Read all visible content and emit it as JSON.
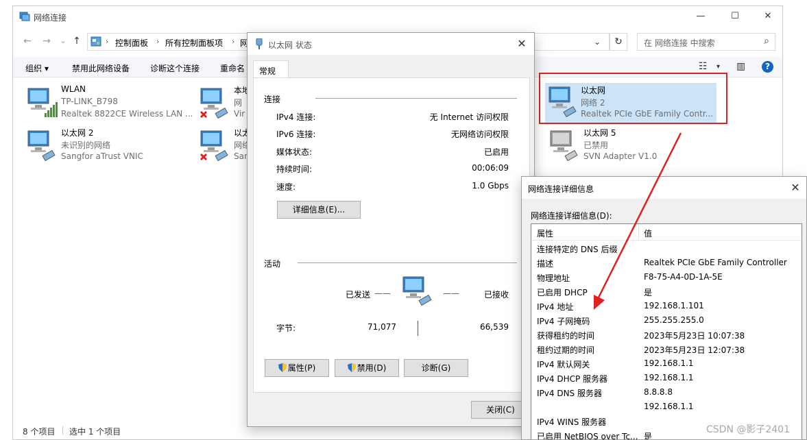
{
  "window": {
    "title": "网络连接",
    "controls": {
      "minimize": "—",
      "maximize": "☐",
      "close": "✕"
    }
  },
  "address": {
    "back": "←",
    "forward": "→",
    "dropdown": "⌄",
    "up": "↑",
    "crumbs": [
      "控制面板",
      "所有控制面板项",
      "网"
    ],
    "sep": "›",
    "dropdown_right": "⌄",
    "refresh": "↻",
    "search_placeholder": "在 网络连接 中搜索",
    "search_icon": "⌕"
  },
  "toolbar": {
    "organize": "组织 ▾",
    "disable": "禁用此网络设备",
    "diagnose": "诊断这个连接",
    "rename": "重命名",
    "view_icon": "☷",
    "view_arrow": "▾",
    "pane_icon": "▥",
    "help": "?"
  },
  "connections": [
    {
      "name": "WLAN",
      "status": "TP-LINK_B798",
      "device": "Realtek 8822CE Wireless LAN ...",
      "state": "wifi"
    },
    {
      "name": "本地",
      "status": "网",
      "device": "Vir",
      "state": "disconnected"
    },
    {
      "name": "以太网",
      "status": "网络 2",
      "device": "Realtek PCIe GbE Family Contr...",
      "state": "connected"
    },
    {
      "name": "以太网 2",
      "status": "未识别的网络",
      "device": "Sangfor aTrust VNIC",
      "state": "connected"
    },
    {
      "name": "以太",
      "status": "网络",
      "device": "Sar",
      "state": "disconnected"
    },
    {
      "name": "以太网 5",
      "status": "已禁用",
      "device": "SVN Adapter V1.0",
      "state": "disabled"
    }
  ],
  "statusbar": {
    "count": "8 个项目",
    "selected": "选中 1 个项目"
  },
  "status_dialog": {
    "title": "以太网 状态",
    "close": "✕",
    "tab": "常规",
    "connection_group": "连接",
    "rows": [
      {
        "label": "IPv4 连接:",
        "value": "无 Internet 访问权限"
      },
      {
        "label": "IPv6 连接:",
        "value": "无网络访问权限"
      },
      {
        "label": "媒体状态:",
        "value": "已启用"
      },
      {
        "label": "持续时间:",
        "value": "00:06:09"
      },
      {
        "label": "速度:",
        "value": "1.0 Gbps"
      }
    ],
    "details_button": "详细信息(E)...",
    "activity_group": "活动",
    "sent_label": "已发送",
    "received_label": "已接收",
    "dash": "——",
    "bytes_label": "字节:",
    "bytes_sent": "71,077",
    "bytes_received": "66,539",
    "properties_button": "属性(P)",
    "disable_button": "禁用(D)",
    "diagnose_button": "诊断(G)",
    "close_button": "关闭(C)"
  },
  "details_dialog": {
    "title": "网络连接详细信息",
    "close": "✕",
    "caption": "网络连接详细信息(D):",
    "col_property": "属性",
    "col_value": "值",
    "rows": [
      {
        "p": "连接特定的 DNS 后缀",
        "v": ""
      },
      {
        "p": "描述",
        "v": "Realtek PCIe GbE Family Controller"
      },
      {
        "p": "物理地址",
        "v": "F8-75-A4-0D-1A-5E"
      },
      {
        "p": "已启用 DHCP",
        "v": "是"
      },
      {
        "p": "IPv4 地址",
        "v": "192.168.1.101"
      },
      {
        "p": "IPv4 子网掩码",
        "v": "255.255.255.0"
      },
      {
        "p": "获得租约的时间",
        "v": "2023年5月23日 10:07:38"
      },
      {
        "p": "租约过期的时间",
        "v": "2023年5月23日 12:07:38"
      },
      {
        "p": "IPv4 默认网关",
        "v": "192.168.1.1"
      },
      {
        "p": "IPv4 DHCP 服务器",
        "v": "192.168.1.1"
      },
      {
        "p": "IPv4 DNS 服务器",
        "v": "8.8.8.8"
      },
      {
        "p": "",
        "v": "192.168.1.1"
      },
      {
        "p": "IPv4 WINS 服务器",
        "v": ""
      },
      {
        "p": "已启用 NetBIOS over Tc...",
        "v": "是"
      }
    ]
  },
  "watermark": "CSDN @影子2401",
  "colors": {
    "highlight_red": "#e0211d",
    "selection": "#cce4f7",
    "accent_blue": "#1464c8"
  }
}
